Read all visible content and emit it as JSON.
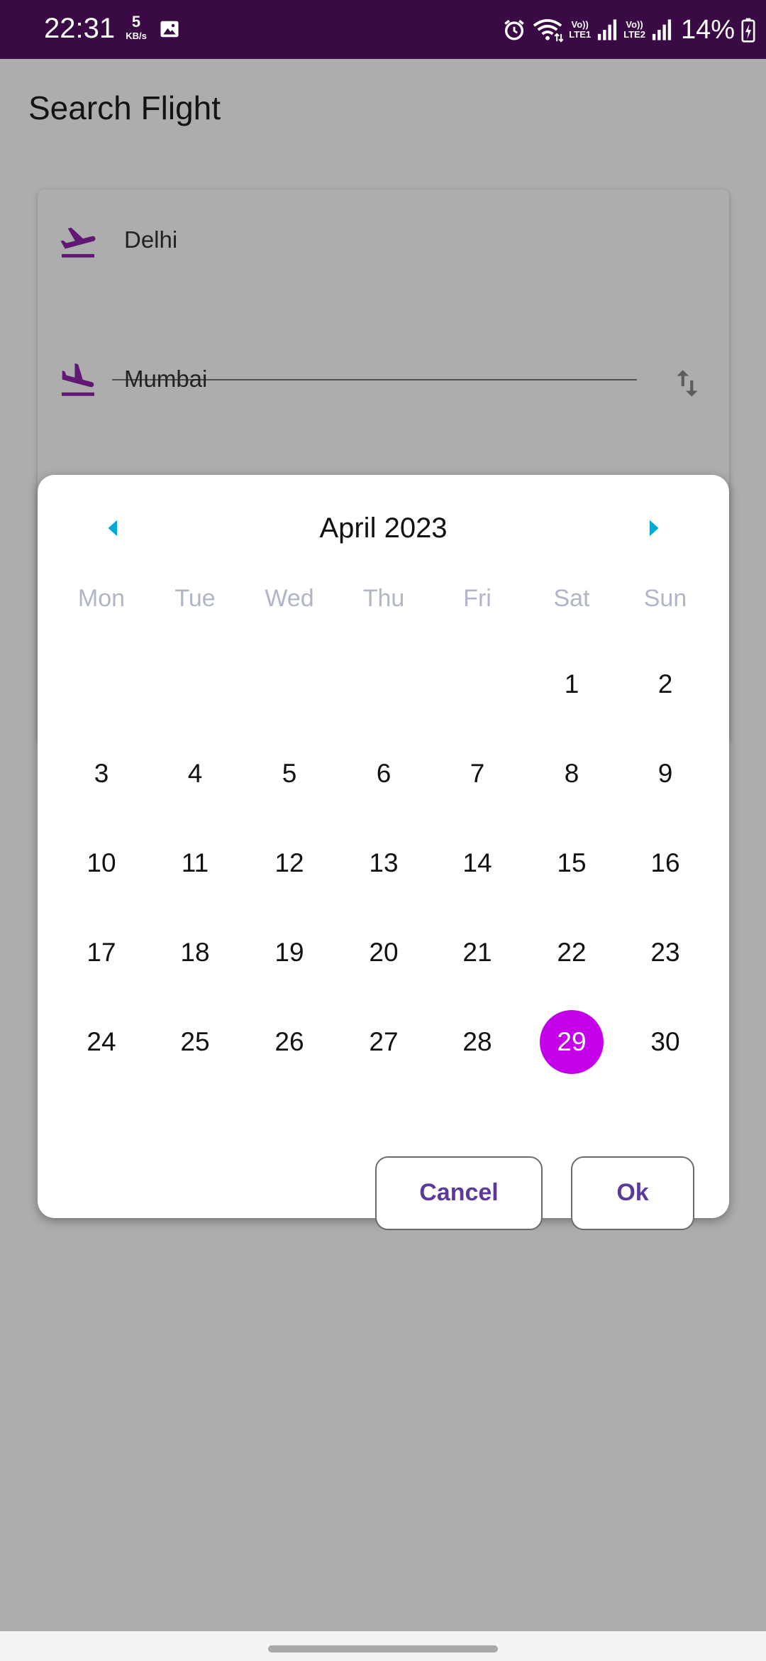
{
  "status_bar": {
    "time": "22:31",
    "data_speed": "5",
    "data_unit": "KB/s",
    "sim1_label_top": "Vo))",
    "sim1_label_bottom": "LTE1",
    "sim2_label_top": "Vo))",
    "sim2_label_bottom": "LTE2",
    "battery": "14%",
    "icons": [
      "gallery-icon",
      "alarm-icon",
      "wifi-icon",
      "signal-icon",
      "battery-charging-icon"
    ]
  },
  "header": {
    "title": "Search Flight"
  },
  "search_form": {
    "from_value": "Delhi",
    "to_value": "Mumbai",
    "icons": {
      "from": "flight-takeoff-icon",
      "to": "flight-land-icon",
      "swap": "swap-vertical-icon"
    },
    "accent_color": "#8e24aa"
  },
  "date_picker": {
    "month_label": "April 2023",
    "weekdays": [
      "Mon",
      "Tue",
      "Wed",
      "Thu",
      "Fri",
      "Sat",
      "Sun"
    ],
    "days": [
      "1",
      "2",
      "3",
      "4",
      "5",
      "6",
      "7",
      "8",
      "9",
      "10",
      "11",
      "12",
      "13",
      "14",
      "15",
      "16",
      "17",
      "18",
      "19",
      "20",
      "21",
      "22",
      "23",
      "24",
      "25",
      "26",
      "27",
      "28",
      "29",
      "30"
    ],
    "first_day_weekday_index": 5,
    "selected_day": "29",
    "selected_color": "#c400e8",
    "nav_arrow_color": "#00a8d8",
    "cancel_label": "Cancel",
    "ok_label": "Ok"
  }
}
